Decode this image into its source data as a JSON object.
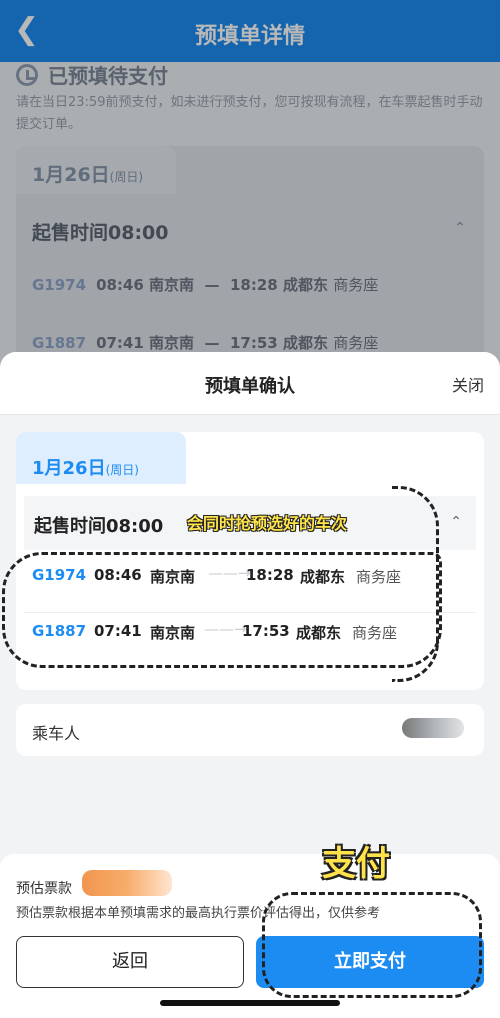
{
  "header": {
    "back_icon": "chevron-left-icon",
    "title": "预填单详情"
  },
  "status": {
    "title": "已预填待支付",
    "desc": "请在当日23:59前预支付，如未进行预支付，您可按现有流程，在车票起售时手动提交订单。"
  },
  "bg_card": {
    "date": "1月26日",
    "weekday": "(周日)",
    "sale_time": "起售时间08:00",
    "trains": [
      {
        "code": "G1974",
        "dep_time": "08:46",
        "dep": "南京南",
        "arr_time": "18:28",
        "arr": "成都东",
        "seat": "商务座"
      },
      {
        "code": "G1887",
        "dep_time": "07:41",
        "dep": "南京南",
        "arr_time": "17:53",
        "arr": "成都东",
        "seat": "商务座"
      }
    ]
  },
  "sheet": {
    "title": "预填单确认",
    "close": "关闭",
    "date": "1月26日",
    "weekday": "(周日)",
    "sale_time": "起售时间08:00",
    "annotation": "会同时抢预选好的车次",
    "trains": [
      {
        "code": "G1974",
        "dep_time": "08:46",
        "dep": "南京南",
        "arr_time": "18:28",
        "arr": "成都东",
        "seat": "商务座"
      },
      {
        "code": "G1887",
        "dep_time": "07:41",
        "dep": "南京南",
        "arr_time": "17:53",
        "arr": "成都东",
        "seat": "商务座"
      }
    ],
    "passenger_label": "乘车人"
  },
  "bottom": {
    "estimate_label": "预估票款",
    "note": "预估票款根据本单预填需求的最高执行票价评估得出，仅供参考",
    "back_button": "返回",
    "pay_button": "立即支付",
    "pay_annotation": "支付"
  },
  "colors": {
    "primary": "#1c8cf2",
    "annotation": "#ffe34a"
  }
}
